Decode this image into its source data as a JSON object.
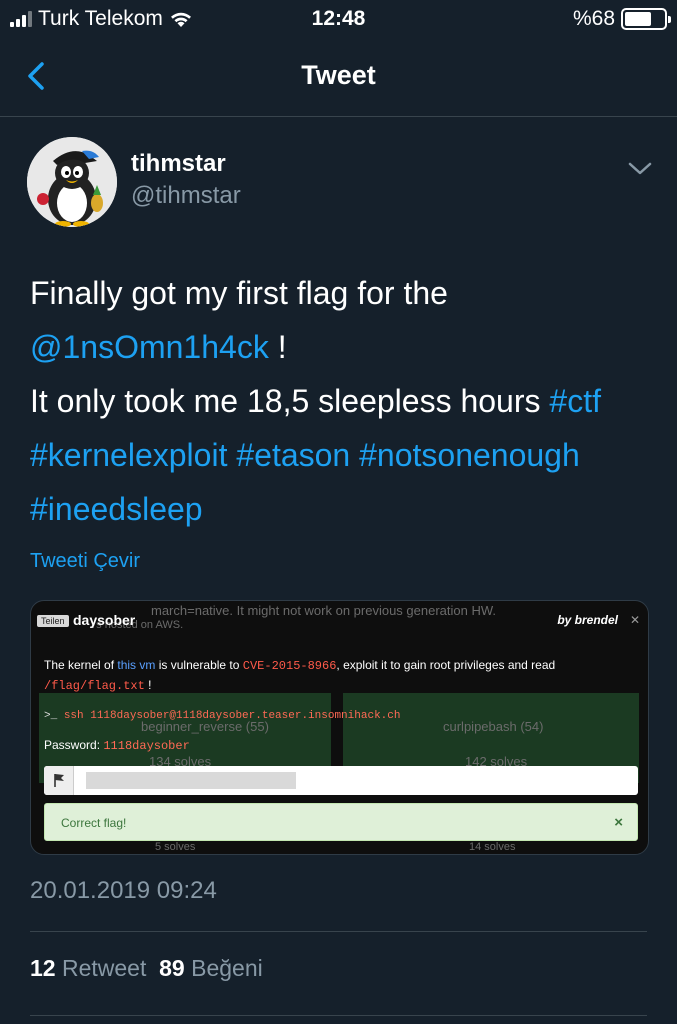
{
  "status_bar": {
    "carrier": "Turk Telekom",
    "time": "12:48",
    "battery_percent": "%68",
    "battery_level": 0.68
  },
  "nav": {
    "title": "Tweet",
    "back_icon": "chevron-left-icon"
  },
  "tweet": {
    "display_name": "tihmstar",
    "handle": "@tihmstar",
    "text": {
      "part1": "Finally got my first flag for the ",
      "mention": "@1nsOmn1h4ck",
      "part2": " !",
      "part3": "It only took me 18,5 sleepless hours ",
      "hashtags": [
        "#ctf",
        "#kernelexploit",
        "#etason",
        "#notsonenough",
        "#ineedsleep"
      ]
    },
    "translate_label": "Tweeti Çevir",
    "timestamp": "20.01.2019 09:24",
    "retweet_count": "12",
    "retweet_label": "Retweet",
    "like_count": "89",
    "like_label": "Beğeni"
  },
  "media": {
    "bg_top_text": "march=native. It might not work on previous generation HW.",
    "bg_top_text2": "t's hosted on AWS.",
    "bg_left_title": "beginner_reverse (55)",
    "bg_left_solves": "134 solves",
    "bg_right_title": "curlpipebash (54)",
    "bg_right_solves": "142 solves",
    "bg_left_bottom": "5 solves",
    "bg_right_bottom": "14 solves",
    "share_label": "Teilen",
    "challenge_title": "daysober",
    "author": "by brendel",
    "desc_1": "The kernel of ",
    "desc_link": "this vm",
    "desc_2": " is vulnerable to ",
    "desc_cve": "CVE-2015-8966",
    "desc_3": ", exploit it to gain root privileges and read",
    "desc_path": "/flag/flag.txt",
    "desc_4": " !",
    "cmd_prompt": ">_",
    "cmd": "ssh 1118daysober@1118daysober.teaser.insomnihack.ch",
    "password_label": "Password: ",
    "password": "1118daysober",
    "correct_label": "Correct flag!",
    "correct_close": "×"
  },
  "colors": {
    "background": "#15202b",
    "accent": "#1da1f2",
    "muted": "#8899a6",
    "divider": "#38444d"
  }
}
